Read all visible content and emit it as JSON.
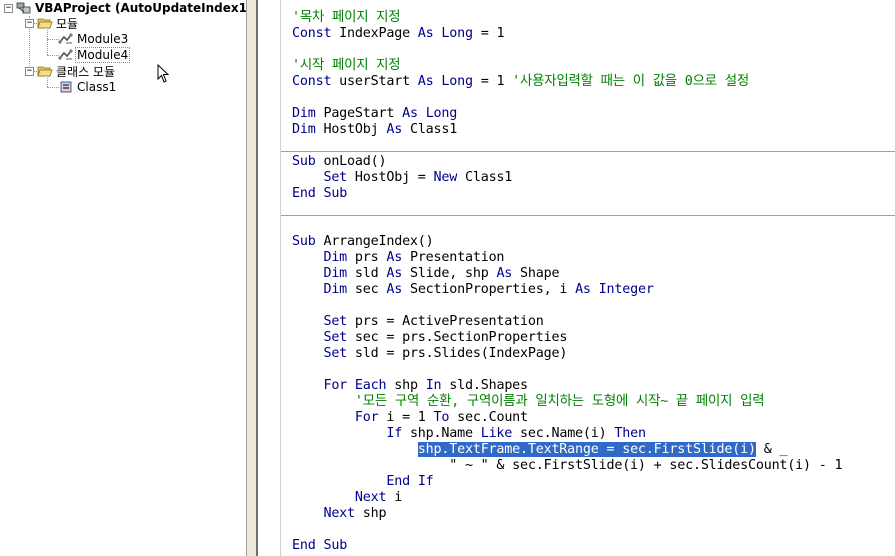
{
  "tree": {
    "root": {
      "label": "VBAProject (AutoUpdateIndex1."
    },
    "modules_folder": {
      "label": "모듈"
    },
    "modules": [
      {
        "label": "Module3"
      },
      {
        "label": "Module4"
      }
    ],
    "class_folder": {
      "label": "클래스 모듈"
    },
    "classes": [
      {
        "label": "Class1"
      }
    ],
    "expand_minus": "−"
  },
  "code": {
    "lines": [
      [
        {
          "t": "'목차 페이지 지정",
          "c": "cm"
        }
      ],
      [
        {
          "t": "Const",
          "c": "kw"
        },
        {
          "t": " IndexPage "
        },
        {
          "t": "As",
          "c": "kw"
        },
        {
          "t": " "
        },
        {
          "t": "Long",
          "c": "kw"
        },
        {
          "t": " = 1"
        }
      ],
      [],
      [
        {
          "t": "'시작 페이지 지정",
          "c": "cm"
        }
      ],
      [
        {
          "t": "Const",
          "c": "kw"
        },
        {
          "t": " userStart "
        },
        {
          "t": "As",
          "c": "kw"
        },
        {
          "t": " "
        },
        {
          "t": "Long",
          "c": "kw"
        },
        {
          "t": " = 1 "
        },
        {
          "t": "'사용자입력할 때는 이 값을 0으로 설정",
          "c": "cm"
        }
      ],
      [],
      [
        {
          "t": "Dim",
          "c": "kw"
        },
        {
          "t": " PageStart "
        },
        {
          "t": "As",
          "c": "kw"
        },
        {
          "t": " "
        },
        {
          "t": "Long",
          "c": "kw"
        }
      ],
      [
        {
          "t": "Dim",
          "c": "kw"
        },
        {
          "t": " HostObj "
        },
        {
          "t": "As",
          "c": "kw"
        },
        {
          "t": " Class1"
        }
      ],
      [],
      [
        {
          "t": "Sub",
          "c": "kw"
        },
        {
          "t": " onLoad()"
        }
      ],
      [
        {
          "t": "    "
        },
        {
          "t": "Set",
          "c": "kw"
        },
        {
          "t": " HostObj = "
        },
        {
          "t": "New",
          "c": "kw"
        },
        {
          "t": " Class1"
        }
      ],
      [
        {
          "t": "End",
          "c": "kw"
        },
        {
          "t": " "
        },
        {
          "t": "Sub",
          "c": "kw"
        }
      ],
      [],
      [],
      [
        {
          "t": "Sub",
          "c": "kw"
        },
        {
          "t": " ArrangeIndex()"
        }
      ],
      [
        {
          "t": "    "
        },
        {
          "t": "Dim",
          "c": "kw"
        },
        {
          "t": " prs "
        },
        {
          "t": "As",
          "c": "kw"
        },
        {
          "t": " Presentation"
        }
      ],
      [
        {
          "t": "    "
        },
        {
          "t": "Dim",
          "c": "kw"
        },
        {
          "t": " sld "
        },
        {
          "t": "As",
          "c": "kw"
        },
        {
          "t": " Slide, shp "
        },
        {
          "t": "As",
          "c": "kw"
        },
        {
          "t": " Shape"
        }
      ],
      [
        {
          "t": "    "
        },
        {
          "t": "Dim",
          "c": "kw"
        },
        {
          "t": " sec "
        },
        {
          "t": "As",
          "c": "kw"
        },
        {
          "t": " SectionProperties, i "
        },
        {
          "t": "As",
          "c": "kw"
        },
        {
          "t": " "
        },
        {
          "t": "Integer",
          "c": "kw"
        }
      ],
      [],
      [
        {
          "t": "    "
        },
        {
          "t": "Set",
          "c": "kw"
        },
        {
          "t": " prs = ActivePresentation"
        }
      ],
      [
        {
          "t": "    "
        },
        {
          "t": "Set",
          "c": "kw"
        },
        {
          "t": " sec = prs.SectionProperties"
        }
      ],
      [
        {
          "t": "    "
        },
        {
          "t": "Set",
          "c": "kw"
        },
        {
          "t": " sld = prs.Slides(IndexPage)"
        }
      ],
      [],
      [
        {
          "t": "    "
        },
        {
          "t": "For",
          "c": "kw"
        },
        {
          "t": " "
        },
        {
          "t": "Each",
          "c": "kw"
        },
        {
          "t": " shp "
        },
        {
          "t": "In",
          "c": "kw"
        },
        {
          "t": " sld.Shapes"
        }
      ],
      [
        {
          "t": "        "
        },
        {
          "t": "'모든 구역 순환, 구역이름과 일치하는 도형에 시작~ 끝 페이지 입력",
          "c": "cm"
        }
      ],
      [
        {
          "t": "        "
        },
        {
          "t": "For",
          "c": "kw"
        },
        {
          "t": " i = 1 "
        },
        {
          "t": "To",
          "c": "kw"
        },
        {
          "t": " sec.Count"
        }
      ],
      [
        {
          "t": "            "
        },
        {
          "t": "If",
          "c": "kw"
        },
        {
          "t": " shp.Name "
        },
        {
          "t": "Like",
          "c": "kw"
        },
        {
          "t": " sec.Name(i) "
        },
        {
          "t": "Then",
          "c": "kw"
        }
      ],
      [
        {
          "t": "                "
        },
        {
          "t": "shp.TextFrame.TextRange = sec.FirstSlide(i)",
          "c": "sel"
        },
        {
          "t": " & _"
        }
      ],
      [
        {
          "t": "                    \" ~ \" & sec.FirstSlide(i) + sec.SlidesCount(i) - 1"
        }
      ],
      [
        {
          "t": "            "
        },
        {
          "t": "End",
          "c": "kw"
        },
        {
          "t": " "
        },
        {
          "t": "If",
          "c": "kw"
        }
      ],
      [
        {
          "t": "        "
        },
        {
          "t": "Next",
          "c": "kw"
        },
        {
          "t": " i"
        }
      ],
      [
        {
          "t": "    "
        },
        {
          "t": "Next",
          "c": "kw"
        },
        {
          "t": " shp"
        }
      ],
      [],
      [
        {
          "t": "End",
          "c": "kw"
        },
        {
          "t": " "
        },
        {
          "t": "Sub",
          "c": "kw"
        }
      ]
    ],
    "separator_after_lines": [
      8,
      12
    ]
  },
  "colors": {
    "keyword": "#00008b",
    "comment": "#008000",
    "selection": "#3169c6"
  }
}
